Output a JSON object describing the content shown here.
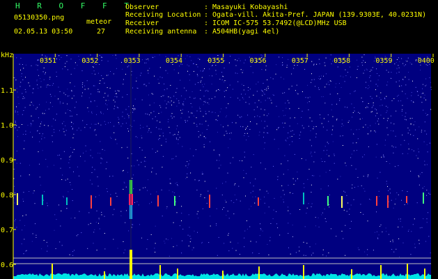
{
  "header": {
    "app_name": "H R O F F T",
    "filename": "05130350.png",
    "datetime": "02.05.13 03:50",
    "meteor_label": "meteor",
    "meteor_count": "27",
    "observer_label": "Observer",
    "observer_value": ": Masayuki Kobayashi",
    "location_label": "Receiving Location",
    "location_value": ": Ogata-vill. Akita-Pref. JAPAN (139.9303E, 40.0231N)",
    "receiver_label": "Receiver",
    "receiver_value": ": ICOM IC-575 53.7492(@LCD)MHz USB",
    "antenna_label": "Receiving antenna",
    "antenna_value": ": A504HB(yagi 4el)"
  },
  "spectrogram": {
    "y_unit": "kHz",
    "y_ticks": [
      "1.1",
      "1.0",
      "0.9",
      "0.8",
      "0.7",
      "0.6"
    ],
    "time_labels": [
      "0351",
      "0352",
      "0353",
      "0354",
      "0355",
      "0356",
      "0357",
      "0358",
      "0359",
      "0400"
    ],
    "colors": {
      "background": "#000080",
      "text": "#ffff00",
      "accent_title": "#33ff66",
      "noise_floor": "#00e5e5",
      "peak": "#ffff00"
    }
  }
}
